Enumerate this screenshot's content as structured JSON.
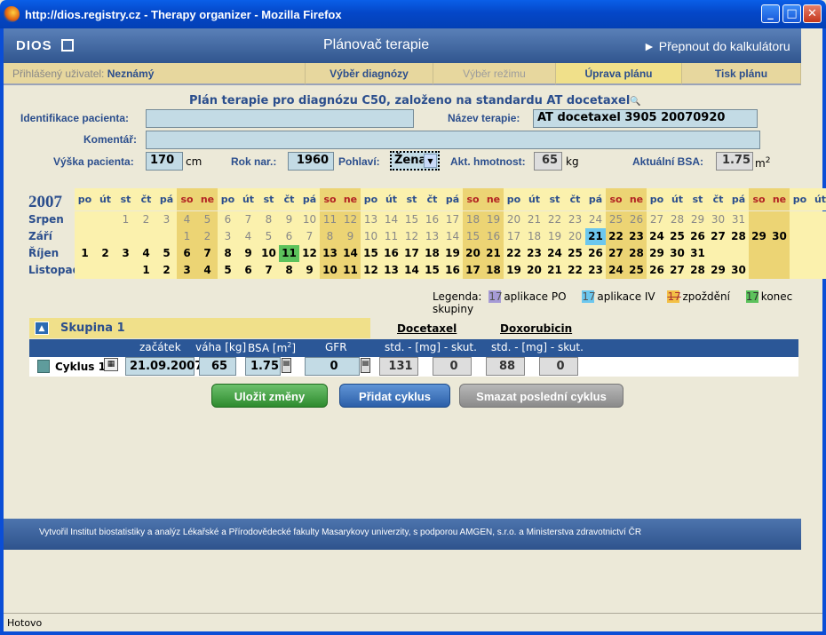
{
  "window": {
    "title": "http://dios.registry.cz - Therapy organizer - Mozilla Firefox"
  },
  "header": {
    "logo": "DIOS",
    "title": "Plánovač terapie",
    "switch_link": "► Přepnout do kalkulátoru"
  },
  "nav": {
    "user_label": "Přihlášený uživatel:",
    "user_value": "Neznámý",
    "tabs": [
      "Výběr diagnózy",
      "Výběr režimu",
      "Úprava plánu",
      "Tisk plánu"
    ]
  },
  "form": {
    "plan_title": "Plán terapie pro diagnózu C50, založeno na standardu AT docetaxel",
    "patient_id_label": "Identifikace pacienta:",
    "patient_id_value": "",
    "therapy_name_label": "Název terapie:",
    "therapy_name_value": "AT docetaxel 3905 20070920",
    "comment_label": "Komentář:",
    "comment_value": "",
    "height_label": "Výška pacienta:",
    "height_value": "170",
    "height_unit": "cm",
    "birth_label": "Rok nar.:",
    "birth_value": "1960",
    "sex_label": "Pohlaví:",
    "sex_value": "Žena",
    "weight_label": "Akt. hmotnost:",
    "weight_value": "65",
    "weight_unit": "kg",
    "bsa_label": "Aktuální BSA:",
    "bsa_value": "1.75",
    "bsa_unit": "m",
    "bsa_sup": "2"
  },
  "calendar": {
    "year": "2007",
    "weekday_headers": [
      "po",
      "út",
      "st",
      "čt",
      "pá",
      "so",
      "ne",
      "po",
      "út",
      "st",
      "čt",
      "pá",
      "so",
      "ne",
      "po",
      "út",
      "st",
      "čt",
      "pá",
      "so",
      "ne",
      "po",
      "út",
      "st",
      "čt",
      "pá",
      "so",
      "ne",
      "po",
      "út",
      "st",
      "čt",
      "pá",
      "so",
      "ne",
      "po",
      "út"
    ],
    "months": [
      {
        "name": "Srpen",
        "days": [
          "",
          "",
          "1",
          "2",
          "3",
          "4",
          "5",
          "6",
          "7",
          "8",
          "9",
          "10",
          "11",
          "12",
          "13",
          "14",
          "15",
          "16",
          "17",
          "18",
          "19",
          "20",
          "21",
          "22",
          "23",
          "24",
          "25",
          "26",
          "27",
          "28",
          "29",
          "30",
          "31",
          "",
          "",
          "",
          ""
        ]
      },
      {
        "name": "Září",
        "days": [
          "",
          "",
          "",
          "",
          "",
          "1",
          "2",
          "3",
          "4",
          "5",
          "6",
          "7",
          "8",
          "9",
          "10",
          "11",
          "12",
          "13",
          "14",
          "15",
          "16",
          "17",
          "18",
          "19",
          "20",
          "21",
          "22",
          "23",
          "24",
          "25",
          "26",
          "27",
          "28",
          "29",
          "30",
          "",
          ""
        ]
      },
      {
        "name": "Říjen",
        "days": [
          "1",
          "2",
          "3",
          "4",
          "5",
          "6",
          "7",
          "8",
          "9",
          "10",
          "11",
          "12",
          "13",
          "14",
          "15",
          "16",
          "17",
          "18",
          "19",
          "20",
          "21",
          "22",
          "23",
          "24",
          "25",
          "26",
          "27",
          "28",
          "29",
          "30",
          "31",
          "",
          "",
          "",
          "",
          "",
          ""
        ]
      },
      {
        "name": "Listopad",
        "days": [
          "",
          "",
          "",
          "1",
          "2",
          "3",
          "4",
          "5",
          "6",
          "7",
          "8",
          "9",
          "10",
          "11",
          "12",
          "13",
          "14",
          "15",
          "16",
          "17",
          "18",
          "19",
          "20",
          "21",
          "22",
          "23",
          "24",
          "25",
          "26",
          "27",
          "28",
          "29",
          "30",
          "",
          "",
          "",
          ""
        ]
      }
    ],
    "iv_highlight": {
      "month": 1,
      "day": "21",
      "color": "#6cc7ee"
    },
    "end_highlight": {
      "month": 2,
      "day": "11",
      "color": "#5cc25c"
    }
  },
  "legend": {
    "title": "Legenda:",
    "items": [
      {
        "num": "17",
        "label": "aplikace PO",
        "color": "#a69bd6"
      },
      {
        "num": "17",
        "label": "aplikace IV",
        "color": "#6cc7ee"
      },
      {
        "num": "17",
        "label": "zpoždění",
        "color": "#f3c046"
      },
      {
        "num": "17",
        "label": "konec skupiny",
        "color": "#5cc25c"
      }
    ]
  },
  "group": {
    "title": "Skupina 1",
    "drugs": [
      "Docetaxel",
      "Doxorubicin"
    ],
    "col_headers": {
      "start": "začátek",
      "weight": "váha [kg]",
      "bsa": "BSA [m",
      "bsa_sup": "2",
      "bsa_end": "]",
      "gfr": "GFR",
      "dose1": "std. - [mg] - skut.",
      "dose2": "std. - [mg] - skut."
    },
    "cycle": {
      "label": "Cyklus 1",
      "start": "21.09.2007",
      "weight": "65",
      "bsa": "1.75",
      "gfr": "0",
      "docetaxel_std": "131",
      "docetaxel_act": "0",
      "doxorubicin_std": "88",
      "doxorubicin_act": "0"
    }
  },
  "buttons": {
    "save": "Uložit změny",
    "add": "Přidat cyklus",
    "delete": "Smazat poslední cyklus"
  },
  "footer": "Vytvořil Institut biostatistiky a analýz Lékařské a Přírodovědecké fakulty Masarykovy univerzity, s podporou AMGEN, s.r.o. a Ministerstva zdravotnictví ČR",
  "status": "Hotovo"
}
